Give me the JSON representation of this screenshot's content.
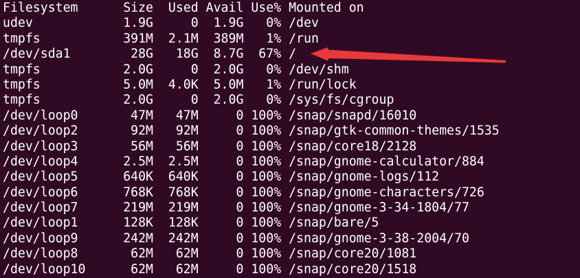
{
  "terminal": {
    "colors": {
      "background": "#300a24",
      "text": "#ffffff",
      "annotation": "#e8393b"
    },
    "lines": [
      "Filesystem      Size  Used Avail Use% Mounted on",
      "udev            1.9G     0  1.9G   0% /dev",
      "tmpfs           391M  2.1M  389M   1% /run",
      "/dev/sda1        28G   18G  8.7G  67% /",
      "tmpfs           2.0G     0  2.0G   0% /dev/shm",
      "tmpfs           5.0M  4.0K  5.0M   1% /run/lock",
      "tmpfs           2.0G     0  2.0G   0% /sys/fs/cgroup",
      "/dev/loop0       47M   47M     0 100% /snap/snapd/16010",
      "/dev/loop2       92M   92M     0 100% /snap/gtk-common-themes/1535",
      "/dev/loop3       56M   56M     0 100% /snap/core18/2128",
      "/dev/loop4      2.5M  2.5M     0 100% /snap/gnome-calculator/884",
      "/dev/loop5      640K  640K     0 100% /snap/gnome-logs/112",
      "/dev/loop6      768K  768K     0 100% /snap/gnome-characters/726",
      "/dev/loop7      219M  219M     0 100% /snap/gnome-3-34-1804/77",
      "/dev/loop1      128K  128K     0 100% /snap/bare/5",
      "/dev/loop9      242M  242M     0 100% /snap/gnome-3-38-2004/70",
      "/dev/loop8       62M   62M     0 100% /snap/core20/1081",
      "/dev/loop10      62M   62M     0 100% /snap/core20/1518"
    ]
  }
}
